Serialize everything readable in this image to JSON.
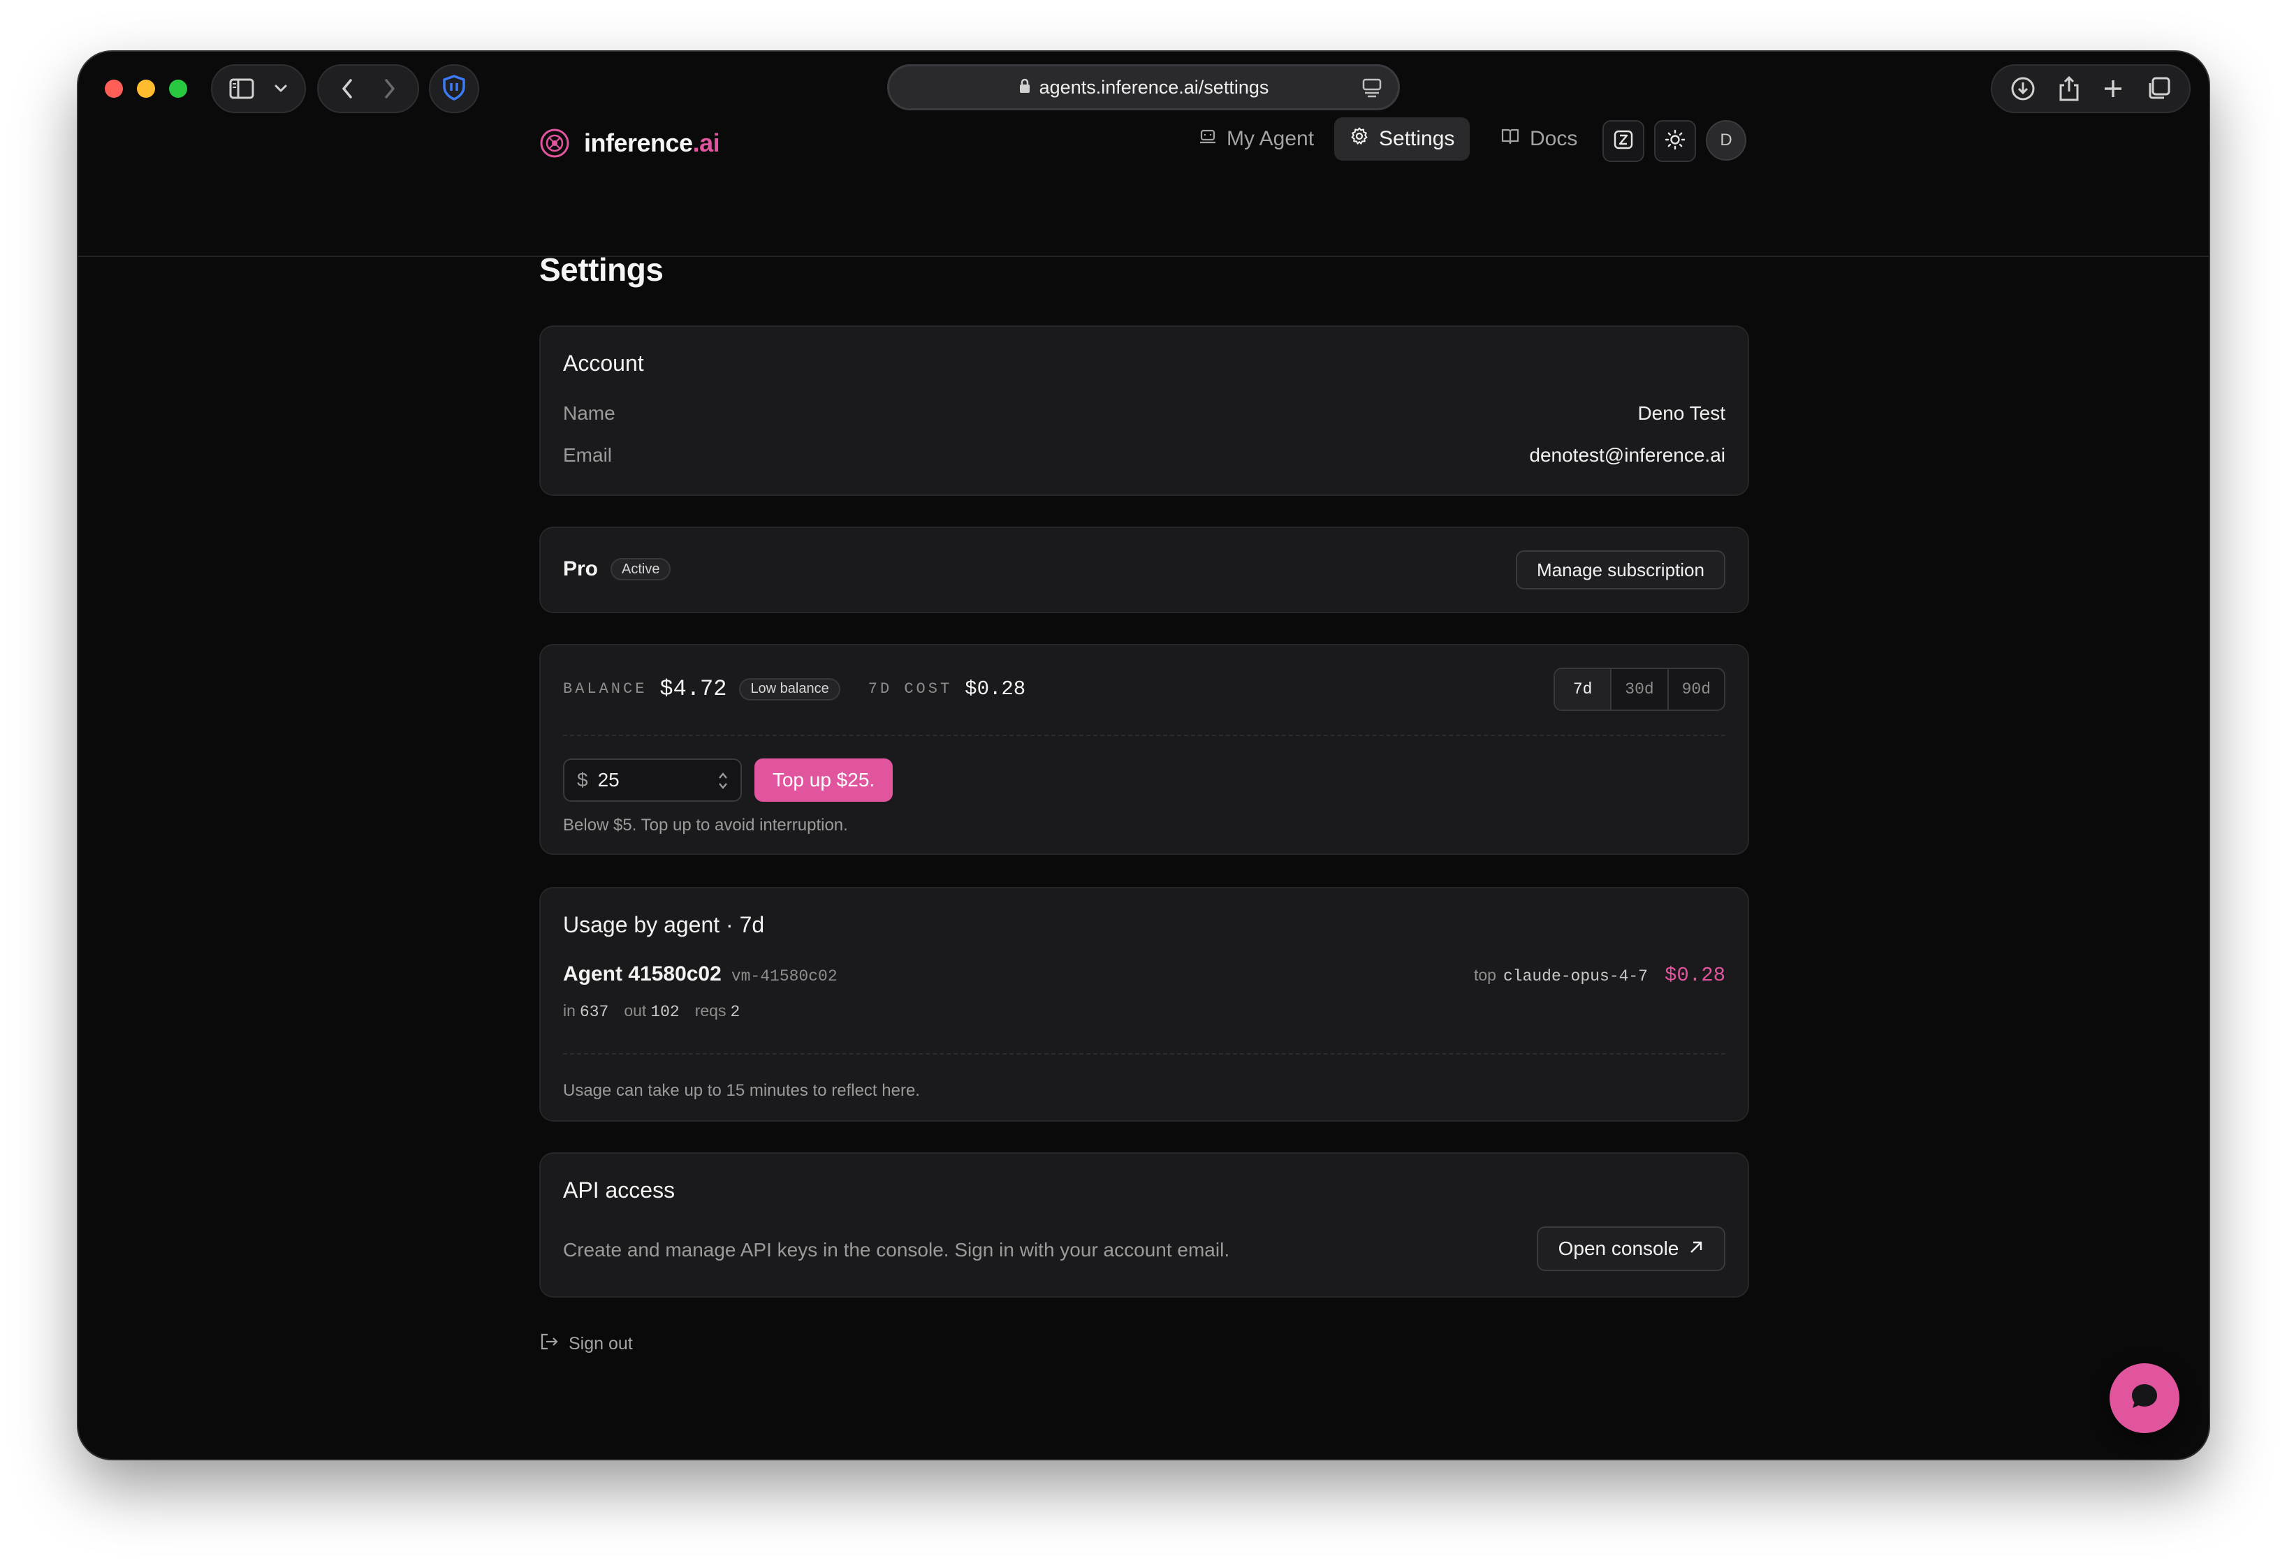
{
  "browser": {
    "url": "agents.inference.ai/settings"
  },
  "brand": {
    "name_main": "inference",
    "name_suffix": ".ai",
    "accent": "#e0559e"
  },
  "nav": {
    "my_agent": "My Agent",
    "settings": "Settings",
    "docs": "Docs",
    "avatar_initial": "D"
  },
  "page": {
    "title": "Settings"
  },
  "account": {
    "title": "Account",
    "name_label": "Name",
    "name_value": "Deno Test",
    "email_label": "Email",
    "email_value": "denotest@inference.ai"
  },
  "plan": {
    "name": "Pro",
    "status": "Active",
    "manage_label": "Manage subscription"
  },
  "billing": {
    "balance_label": "BALANCE",
    "balance_value": "$4.72",
    "low_balance_badge": "Low balance",
    "cost_label": "7D COST",
    "cost_value": "$0.28",
    "ranges": [
      "7d",
      "30d",
      "90d"
    ],
    "selected_range": "7d",
    "currency_symbol": "$",
    "amount_value": "25",
    "topup_label": "Top up $25.",
    "hint": "Below $5. Top up to avoid interruption."
  },
  "usage": {
    "title": "Usage by agent · 7d",
    "agent_name": "Agent 41580c02",
    "agent_vm": "vm-41580c02",
    "top_label": "top",
    "top_model": "claude-opus-4-7",
    "agent_cost": "$0.28",
    "in_label": "in",
    "in_value": "637",
    "out_label": "out",
    "out_value": "102",
    "reqs_label": "reqs",
    "reqs_value": "2",
    "note": "Usage can take up to 15 minutes to reflect here."
  },
  "api": {
    "title": "API access",
    "description": "Create and manage API keys in the console. Sign in with your account email.",
    "button_label": "Open console"
  },
  "footer": {
    "signout_label": "Sign out"
  },
  "icons": [
    "sidebar-icon",
    "chevron-down-icon",
    "back-icon",
    "forward-icon",
    "shield-icon",
    "lock-icon",
    "reader-icon",
    "download-icon",
    "share-icon",
    "plus-icon",
    "tabs-icon",
    "robot-icon",
    "gear-icon",
    "book-icon",
    "shortcut-icon",
    "sun-icon",
    "stepper-icon",
    "external-arrow-icon",
    "signout-icon",
    "chat-icon"
  ]
}
